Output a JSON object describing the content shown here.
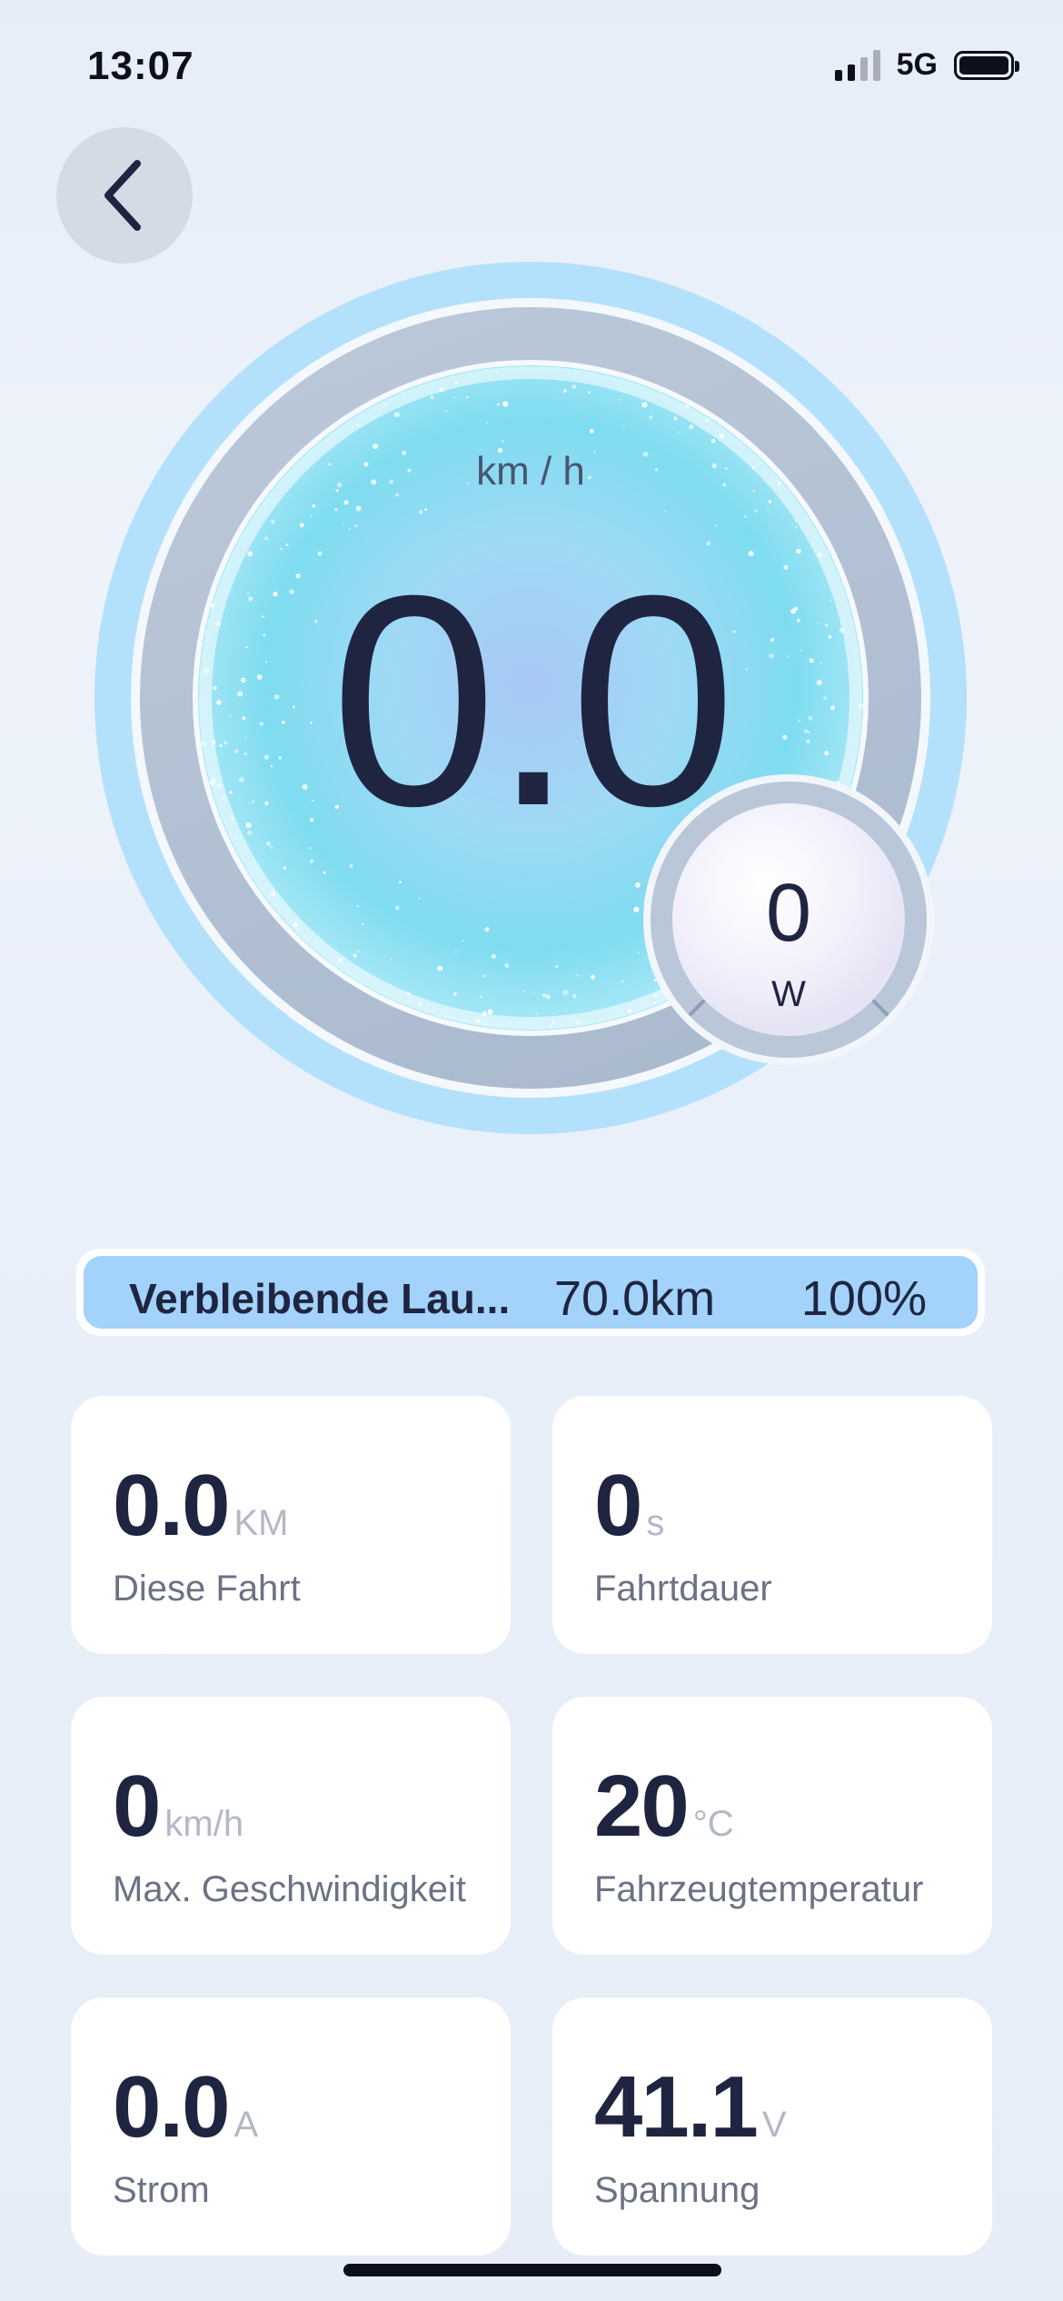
{
  "status_bar": {
    "time": "13:07",
    "network": "5G"
  },
  "speedometer": {
    "unit": "km / h",
    "value": "0.0",
    "power_value": "0",
    "power_unit": "W"
  },
  "range": {
    "label": "Verbleibende Lau...",
    "distance": "70.0km",
    "percent": "100%"
  },
  "stats": [
    {
      "value": "0.0",
      "unit": "KM",
      "label": "Diese Fahrt"
    },
    {
      "value": "0",
      "unit": "s",
      "label": "Fahrtdauer"
    },
    {
      "value": "0",
      "unit": "km/h",
      "label": "Max. Geschwindigkeit"
    },
    {
      "value": "20",
      "unit": "°C",
      "label": "Fahrzeugtemperatur"
    },
    {
      "value": "0.0",
      "unit": "A",
      "label": "Strom"
    },
    {
      "value": "41.1",
      "unit": "V",
      "label": "Spannung"
    }
  ],
  "colors": {
    "accent": "#a3d2fb",
    "outer_ring": "#b3e1fb",
    "text_dark": "#1f2540",
    "unit_gray": "#b3b8c4"
  }
}
